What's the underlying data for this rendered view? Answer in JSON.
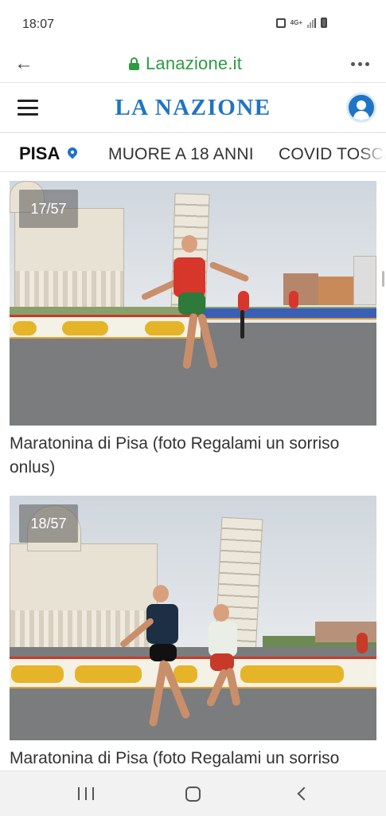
{
  "status_bar": {
    "time": "18:07",
    "network": "4G+",
    "icons": [
      "lock-icon",
      "network-4g-icon",
      "signal-icon",
      "battery-icon"
    ]
  },
  "browser": {
    "url": "Lanazione.it",
    "back_icon": "arrow-left-icon",
    "secure_icon": "lock-icon",
    "menu_icon": "more-dots-icon",
    "accent_color": "#2f9a44"
  },
  "header": {
    "logo": "LA NAZIONE",
    "menu_icon": "hamburger-icon",
    "account_icon": "user-icon",
    "brand_color": "#1f74c5"
  },
  "nav": {
    "home_label": "PISA",
    "home_icon": "location-pin-icon",
    "tabs": [
      {
        "label": "MUORE A 18 ANNI"
      },
      {
        "label": "COVID TOSCA"
      }
    ]
  },
  "gallery": {
    "items": [
      {
        "counter": "17/57",
        "caption": "Maratonina di Pisa (foto Regalami un sorriso onlus)"
      },
      {
        "counter": "18/57",
        "caption": "Maratonina di Pisa (foto Regalami un sorriso"
      }
    ]
  },
  "system_nav": {
    "icons": [
      "recents-icon",
      "home-icon",
      "back-icon"
    ]
  }
}
